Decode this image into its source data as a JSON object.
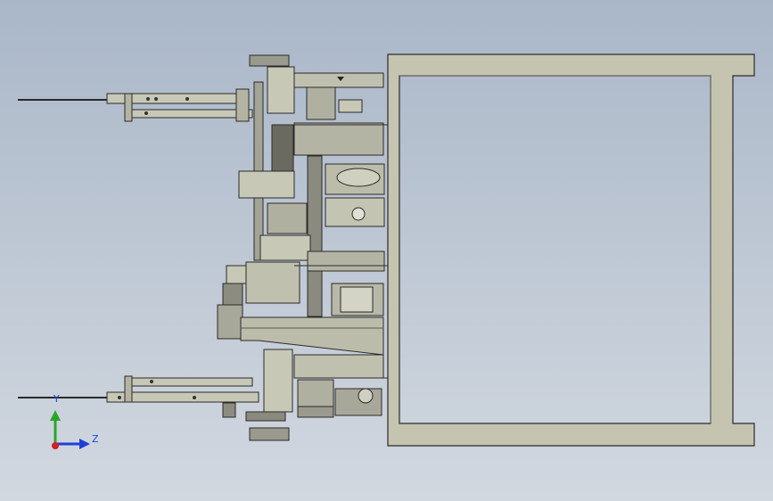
{
  "viewport": {
    "background_top": "#aab7c9",
    "background_bottom": "#d2d8e0"
  },
  "colors": {
    "frame_fill": "#c4c4b0",
    "frame_edge": "#2a2a2a",
    "machine_fill": "#bdbdad",
    "machine_dark": "#6a6a60",
    "axis_y": "#2aa52a",
    "axis_z": "#1f3fd6",
    "axis_origin": "#d02020"
  },
  "triad": {
    "y_label": "Y",
    "z_label": "Z"
  }
}
